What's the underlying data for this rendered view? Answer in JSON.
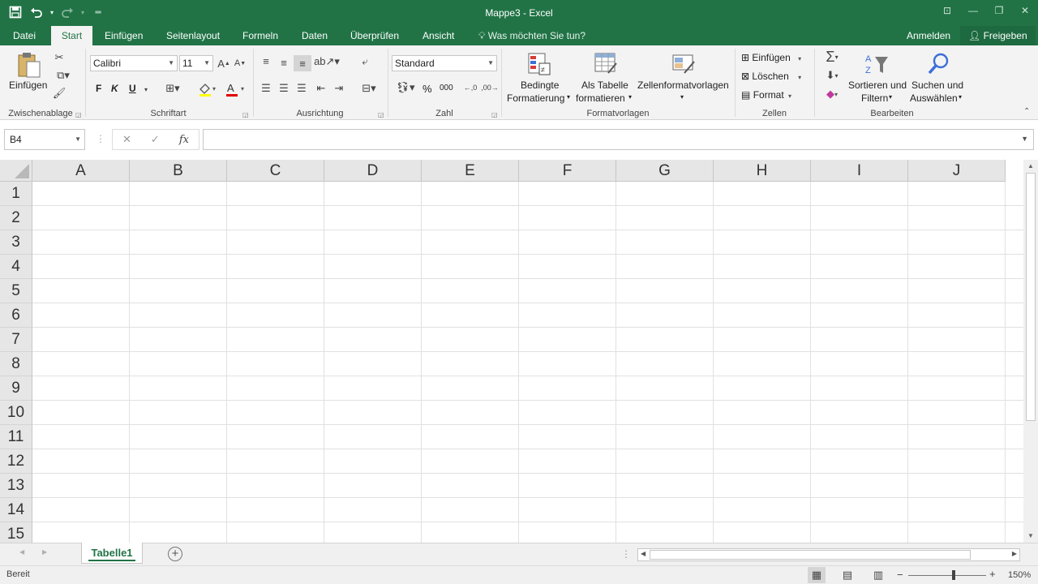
{
  "window": {
    "title": "Mappe3 - Excel"
  },
  "qat": {
    "save_icon": "save-icon",
    "undo_icon": "undo-icon",
    "redo_icon": "redo-icon"
  },
  "tabs": [
    {
      "label": "Datei"
    },
    {
      "label": "Start"
    },
    {
      "label": "Einfügen"
    },
    {
      "label": "Seitenlayout"
    },
    {
      "label": "Formeln"
    },
    {
      "label": "Daten"
    },
    {
      "label": "Überprüfen"
    },
    {
      "label": "Ansicht"
    }
  ],
  "tell_me": {
    "placeholder": "Was möchten Sie tun?"
  },
  "account": {
    "sign_in": "Anmelden",
    "share": "Freigeben"
  },
  "ribbon": {
    "clipboard": {
      "paste_label": "Einfügen",
      "group_label": "Zwischenablage"
    },
    "font": {
      "font_name": "Calibri",
      "font_size": "11",
      "bold": "F",
      "italic": "K",
      "underline": "U",
      "group_label": "Schriftart"
    },
    "alignment": {
      "group_label": "Ausrichtung"
    },
    "number": {
      "format": "Standard",
      "percent": "%",
      "thousands": "000",
      "group_label": "Zahl"
    },
    "styles": {
      "conditional_line1": "Bedingte",
      "conditional_line2": "Formatierung",
      "as_table_line1": "Als Tabelle",
      "as_table_line2": "formatieren",
      "cell_styles": "Zellenformatvorlagen",
      "group_label": "Formatvorlagen"
    },
    "cells": {
      "insert": "Einfügen",
      "delete": "Löschen",
      "format": "Format",
      "group_label": "Zellen"
    },
    "editing": {
      "sort_line1": "Sortieren und",
      "sort_line2": "Filtern",
      "find_line1": "Suchen und",
      "find_line2": "Auswählen",
      "group_label": "Bearbeiten"
    }
  },
  "formula_bar": {
    "name_box": "B4",
    "fx": "fx",
    "formula": ""
  },
  "sheet": {
    "columns": [
      "A",
      "B",
      "C",
      "D",
      "E",
      "F",
      "G",
      "H",
      "I",
      "J"
    ],
    "rows": [
      "1",
      "2",
      "3",
      "4",
      "5",
      "6",
      "7",
      "8",
      "9",
      "10",
      "11",
      "12",
      "13",
      "14",
      "15"
    ]
  },
  "sheet_tabs": [
    {
      "label": "Tabelle1"
    }
  ],
  "status": {
    "ready": "Bereit",
    "zoom": "150%",
    "zoom_level_percent": 150
  },
  "colors": {
    "accent": "#217346"
  }
}
